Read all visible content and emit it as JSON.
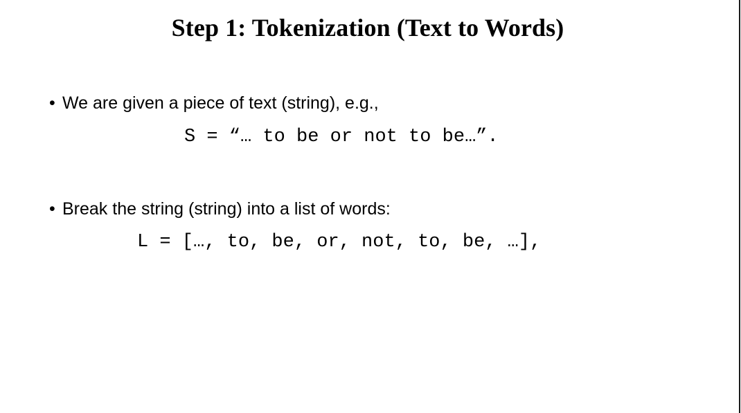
{
  "slide": {
    "title": "Step 1: Tokenization (Text to Words)",
    "background_color": "#ffffff",
    "text_color": "#000000",
    "right_rule_color": "#1a1a1a",
    "bullet_glyph": "•",
    "blocks": [
      {
        "bullet": "We are given a piece of text (string), e.g.,",
        "code": "S = “… to be or not to be…”."
      },
      {
        "bullet": "Break the string (string) into a list of words:",
        "code": "L = […, to, be, or, not, to, be, …],"
      }
    ]
  }
}
